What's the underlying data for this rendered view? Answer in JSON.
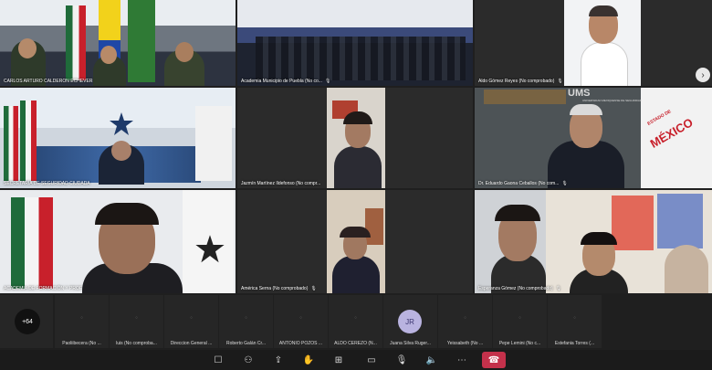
{
  "tiles": [
    {
      "name": "CARLOS ARTURO CALDERON ECHEVER"
    },
    {
      "name": "Academia Municipio de Puebla (No co..."
    },
    {
      "name": "Aldo Gómez Reyes (No comprobado)"
    },
    {
      "name": "SECRETARÍA DE SEGURIDAD CIUDADA"
    },
    {
      "name": "Jazmín Martínez Ildefonso (No compr..."
    },
    {
      "name": "Dr. Eduardo Gaona Ceballos (No com..."
    },
    {
      "name": "ACADEMIA DE FORMACIÓN Y PROF"
    },
    {
      "name": "América Serna  (No comprobado)"
    },
    {
      "name": "Esperanza Gómez (No comprobado)"
    }
  ],
  "strip": {
    "more_count": "+64",
    "avatar_initials": "JR",
    "participants": [
      "Paoliibecera (No ...",
      "luis (No comproba...",
      "Direccion General ...",
      "Roberto Galán Cr...",
      "ANTONIO POZOS ...",
      "ALDO CEREZO (N...",
      "Juana Silva Ruger...",
      "Yeissabeth (No ...",
      "Pepe Lemini (No c...",
      "Estefania Torres (..."
    ]
  },
  "banner_text": {
    "ums": "UMS",
    "ums_sub": "UNIVERSIDAD MEXIQUENSE DE SEGURIDAD",
    "estado": "ESTADO DE",
    "mexico": "MÉXICO"
  },
  "toolbar": {
    "icons": [
      "chat-icon",
      "people-icon",
      "share-icon",
      "reactions-icon",
      "view-icon",
      "camera-off-icon",
      "mic-off-icon",
      "speaker-icon",
      "more-icon",
      "hangup-icon"
    ]
  },
  "colors": {
    "accent": "#7b83eb",
    "hangup": "#c4314b",
    "background": "#1f1f1f"
  }
}
